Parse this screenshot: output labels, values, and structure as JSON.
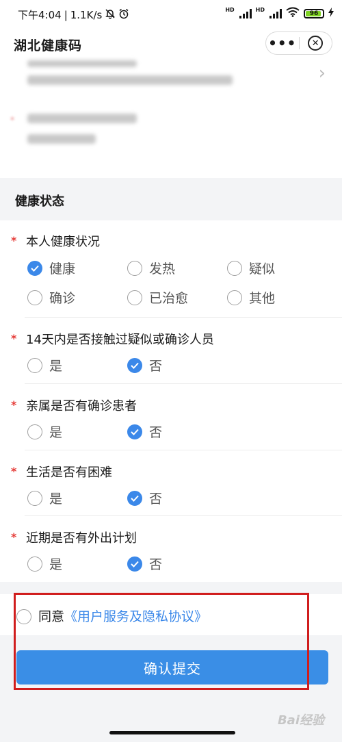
{
  "status_bar": {
    "time": "下午4:04",
    "network_speed": "1.1K/s",
    "hd1": "HD",
    "hd2": "HD",
    "battery": "96"
  },
  "title_bar": {
    "title": "湖北健康码",
    "more_label": "•••",
    "close_label": "✕"
  },
  "section": {
    "title": "健康状态"
  },
  "questions": [
    {
      "label": "本人健康状况",
      "required": "*",
      "options": [
        "健康",
        "发热",
        "疑似",
        "确诊",
        "已治愈",
        "其他"
      ],
      "selected": "健康"
    },
    {
      "label": "14天内是否接触过疑似或确诊人员",
      "required": "*",
      "options": [
        "是",
        "否"
      ],
      "selected": "否"
    },
    {
      "label": "亲属是否有确诊患者",
      "required": "*",
      "options": [
        "是",
        "否"
      ],
      "selected": "否"
    },
    {
      "label": "生活是否有困难",
      "required": "*",
      "options": [
        "是",
        "否"
      ],
      "selected": "否"
    },
    {
      "label": "近期是否有外出计划",
      "required": "*",
      "options": [
        "是",
        "否"
      ],
      "selected": "否"
    }
  ],
  "agreement": {
    "prefix": "同意",
    "link": "《用户服务及隐私协议》",
    "checked": false
  },
  "submit_label": "确认提交",
  "watermark": "Bai经验",
  "colors": {
    "accent": "#3b88e9",
    "required": "#e53935",
    "highlight_box": "#d01d1d"
  }
}
